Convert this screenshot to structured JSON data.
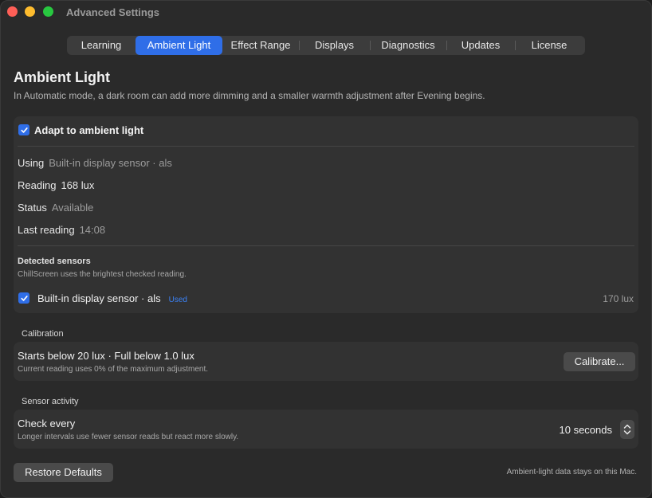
{
  "window": {
    "title": "Advanced Settings"
  },
  "tabs": [
    {
      "label": "Learning"
    },
    {
      "label": "Ambient Light"
    },
    {
      "label": "Effect Range"
    },
    {
      "label": "Displays"
    },
    {
      "label": "Diagnostics"
    },
    {
      "label": "Updates"
    },
    {
      "label": "License"
    }
  ],
  "active_tab": "Ambient Light",
  "page": {
    "title": "Ambient Light",
    "subtitle": "In Automatic mode, a dark room can add more dimming and a smaller warmth adjustment after Evening begins."
  },
  "adapt": {
    "label": "Adapt to ambient light",
    "checked": true,
    "using_label": "Using",
    "using_value": "Built-in display sensor · als",
    "reading_label": "Reading",
    "reading_value": "168 lux",
    "status_label": "Status",
    "status_value": "Available",
    "last_label": "Last reading",
    "last_value": "14:08",
    "sensors_title": "Detected sensors",
    "sensors_desc": "ChillScreen uses the brightest checked reading.",
    "sensors": [
      {
        "name": "Built-in display sensor · als",
        "badge": "Used",
        "value": "170 lux",
        "checked": true
      }
    ]
  },
  "calibration": {
    "section": "Calibration",
    "title": "Starts below 20 lux · Full below 1.0 lux",
    "desc": "Current reading uses 0% of the maximum adjustment.",
    "button": "Calibrate..."
  },
  "activity": {
    "section": "Sensor activity",
    "title": "Check every",
    "desc": "Longer intervals use fewer sensor reads but react more slowly.",
    "value": "10 seconds"
  },
  "footer": {
    "restore": "Restore Defaults",
    "note": "Ambient-light data stays on this Mac."
  },
  "colors": {
    "accent": "#2f6ee8",
    "badge": "#3b82f6",
    "window_bg": "#2a2a2a",
    "panel_bg": "#323232"
  }
}
